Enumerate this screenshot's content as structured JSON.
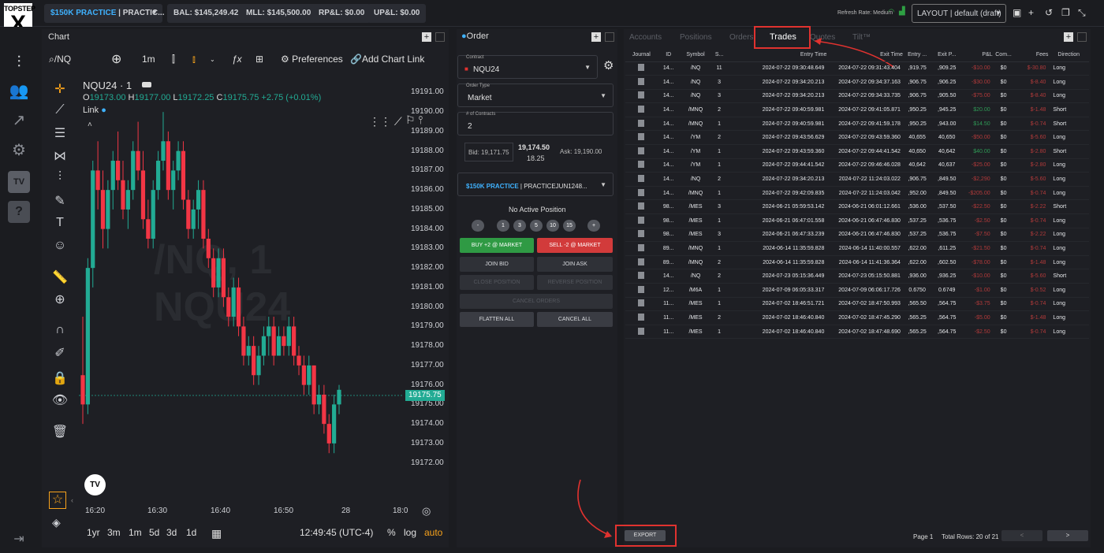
{
  "topbar": {
    "logo_top": "TOPSTEP",
    "logo_bottom": "X",
    "account_highlight": "$150K PRACTICE",
    "account_rest": " | PRACTIC...",
    "bal": "BAL: $145,249.42",
    "mll": "MLL: $145,500.00",
    "rpl": "RP&L: $0.00",
    "upl": "UP&L: $0.00",
    "refresh_rate": "Refresh Rate: Medium",
    "layout": "LAYOUT | default (draft)"
  },
  "chart": {
    "tab_label": "Chart",
    "symbol_search": "/NQ",
    "interval": "1m",
    "preferences": "Preferences",
    "add_chart_link": "Add Chart Link",
    "legend_title": "NQU24 · 1",
    "ohlc": {
      "o_label": "O",
      "o": "19173.00",
      "h_label": "H",
      "h": "19177.00",
      "l_label": "L",
      "l": "19172.25",
      "c_label": "C",
      "c": "19175.75",
      "change": "+2.75 (+0.01%)"
    },
    "link_label": "Link",
    "watermark_line1": "/NQ, 1",
    "watermark_line2": "NQU24",
    "price_tag": "19175.75",
    "timeframes": [
      "1yr",
      "3m",
      "1m",
      "5d",
      "3d",
      "1d"
    ],
    "clock": "12:49:45 (UTC-4)",
    "pct": "%",
    "log": "log",
    "auto": "auto"
  },
  "chart_data": {
    "type": "candlestick",
    "y_ticks": [
      "19191.00",
      "19190.00",
      "19189.00",
      "19188.00",
      "19187.00",
      "19186.00",
      "19185.00",
      "19184.00",
      "19183.00",
      "19182.00",
      "19181.00",
      "19180.00",
      "19179.00",
      "19178.00",
      "19177.00",
      "19176.00",
      "19175.00",
      "19174.00",
      "19173.00",
      "19172.00"
    ],
    "x_ticks": [
      "16:20",
      "16:30",
      "16:40",
      "16:50",
      "28",
      "18:0"
    ],
    "ylim": [
      19171.5,
      19191.3
    ],
    "colors": {
      "up": "#22ab94",
      "down": "#f23645"
    },
    "candles": [
      [
        19176.5,
        19179.5,
        19174.0,
        19175.0
      ],
      [
        19175.0,
        19182.5,
        19174.5,
        19182.0
      ],
      [
        19182.0,
        19187.5,
        19181.0,
        19187.0
      ],
      [
        19187.0,
        19188.5,
        19185.0,
        19186.0
      ],
      [
        19186.0,
        19187.0,
        19183.0,
        19184.0
      ],
      [
        19184.0,
        19186.5,
        19183.0,
        19186.0
      ],
      [
        19186.0,
        19188.0,
        19185.0,
        19187.5
      ],
      [
        19187.5,
        19189.0,
        19186.0,
        19186.5
      ],
      [
        19186.5,
        19187.5,
        19184.5,
        19185.0
      ],
      [
        19185.0,
        19186.5,
        19184.0,
        19186.0
      ],
      [
        19186.0,
        19188.5,
        19185.5,
        19188.0
      ],
      [
        19188.0,
        19189.5,
        19186.5,
        19187.0
      ],
      [
        19187.0,
        19188.0,
        19184.0,
        19184.5
      ],
      [
        19184.5,
        19185.5,
        19183.0,
        19183.5
      ],
      [
        19183.5,
        19186.5,
        19183.0,
        19186.0
      ],
      [
        19186.0,
        19188.0,
        19185.5,
        19187.5
      ],
      [
        19187.5,
        19190.0,
        19187.0,
        19188.5
      ],
      [
        19188.5,
        19189.0,
        19185.5,
        19186.0
      ],
      [
        19186.0,
        19187.5,
        19185.0,
        19187.0
      ],
      [
        19187.0,
        19188.5,
        19186.5,
        19188.0
      ],
      [
        19188.0,
        19188.5,
        19185.0,
        19185.5
      ],
      [
        19185.5,
        19186.0,
        19183.5,
        19184.0
      ],
      [
        19184.0,
        19185.5,
        19183.5,
        19185.0
      ],
      [
        19185.0,
        19186.5,
        19184.0,
        19186.0
      ],
      [
        19186.0,
        19186.5,
        19183.0,
        19183.5
      ],
      [
        19183.5,
        19184.0,
        19182.0,
        19182.5
      ],
      [
        19182.5,
        19183.0,
        19180.5,
        19181.0
      ],
      [
        19181.0,
        19183.0,
        19180.5,
        19182.5
      ],
      [
        19182.5,
        19183.0,
        19180.0,
        19180.5
      ],
      [
        19180.5,
        19181.0,
        19179.0,
        19179.5
      ],
      [
        19179.5,
        19181.5,
        19179.0,
        19181.0
      ],
      [
        19181.0,
        19181.5,
        19178.5,
        19179.0
      ],
      [
        19179.0,
        19179.5,
        19177.0,
        19177.5
      ],
      [
        19177.5,
        19178.5,
        19177.0,
        19178.0
      ],
      [
        19178.0,
        19178.5,
        19176.0,
        19176.5
      ],
      [
        19176.5,
        19178.0,
        19176.0,
        19177.5
      ],
      [
        19177.5,
        19179.0,
        19177.0,
        19178.5
      ],
      [
        19178.5,
        19179.5,
        19177.5,
        19179.0
      ],
      [
        19179.0,
        19179.5,
        19177.0,
        19177.5
      ],
      [
        19177.5,
        19179.0,
        19177.5,
        19178.5
      ],
      [
        19178.5,
        19179.0,
        19177.5,
        19178.0
      ],
      [
        19178.0,
        19179.5,
        19177.5,
        19179.0
      ],
      [
        19179.0,
        19179.5,
        19177.0,
        19177.5
      ],
      [
        19177.5,
        19178.0,
        19176.5,
        19177.0
      ],
      [
        19177.0,
        19177.5,
        19175.5,
        19176.0
      ],
      [
        19176.0,
        19177.5,
        19175.5,
        19177.0
      ],
      [
        19177.0,
        19177.0,
        19174.5,
        19175.0
      ],
      [
        19175.0,
        19176.0,
        19174.5,
        19175.5
      ],
      [
        19175.5,
        19176.0,
        19173.5,
        19174.0
      ],
      [
        19174.0,
        19174.5,
        19172.5,
        19173.0
      ],
      [
        19173.0,
        19175.5,
        19172.5,
        19175.0
      ],
      [
        19175.0,
        19176.0,
        19174.5,
        19175.75
      ]
    ]
  },
  "order": {
    "tab_label": "Order",
    "contract_label": "Contract",
    "contract_value": "NQU24",
    "order_type_label": "Order Type",
    "order_type_value": "Market",
    "contracts_label": "# of Contracts",
    "contracts_value": "2",
    "bid": "Bid: 19,171.75",
    "last": "19,174.50",
    "spread": "18.25",
    "ask": "Ask: 19,190.00",
    "account_highlight": "$150K PRACTICE",
    "account_rest": " | PRACTICEJUN1248...",
    "position_status": "No Active Position",
    "qty_buttons": [
      "-",
      "1",
      "3",
      "5",
      "10",
      "15",
      "+"
    ],
    "buy": "BUY +2 @ MARKET",
    "sell": "SELL -2 @ MARKET",
    "join_bid": "JOIN BID",
    "join_ask": "JOIN ASK",
    "close_position": "CLOSE POSITION",
    "reverse_position": "REVERSE POSITION",
    "cancel_orders": "CANCEL ORDERS",
    "flatten_all": "FLATTEN ALL",
    "cancel_all": "CANCEL ALL"
  },
  "trades": {
    "tabs": [
      "Accounts",
      "Positions",
      "Orders",
      "Trades",
      "Quotes",
      "Tilt™"
    ],
    "columns": [
      "Journal",
      "ID",
      "Symbol",
      "S...",
      "Entry Time",
      "Exit Time",
      "Entry ...",
      "Exit P...",
      "P&L",
      "Com...",
      "Fees",
      "Direction"
    ],
    "rows": [
      [
        "14...",
        "/NQ",
        "11",
        "2024-07-22 09:30:48.649",
        "2024-07-22 09:31:43.404",
        ",919.75",
        ",909.25",
        "-$10.00",
        "$0",
        "$-30.80",
        "Long"
      ],
      [
        "14...",
        "/NQ",
        "3",
        "2024-07-22 09:34:20.213",
        "2024-07-22 09:34:37.163",
        ",906.75",
        ",906.25",
        "-$30.00",
        "$0",
        "$-8.40",
        "Long"
      ],
      [
        "14...",
        "/NQ",
        "3",
        "2024-07-22 09:34:20.213",
        "2024-07-22 09:34:33.735",
        ",906.75",
        ",905.50",
        "-$75.00",
        "$0",
        "$-8.40",
        "Long"
      ],
      [
        "14...",
        "/MNQ",
        "2",
        "2024-07-22 09:40:59.981",
        "2024-07-22 09:41:05.871",
        ",950.25",
        ",945.25",
        "$20.00",
        "$0",
        "$-1.48",
        "Short"
      ],
      [
        "14...",
        "/MNQ",
        "1",
        "2024-07-22 09:40:59.981",
        "2024-07-22 09:41:59.178",
        ",950.25",
        ",943.00",
        "$14.50",
        "$0",
        "$-0.74",
        "Short"
      ],
      [
        "14...",
        "/YM",
        "2",
        "2024-07-22 09:43:56.629",
        "2024-07-22 09:43:59.360",
        "40,655",
        "40,650",
        "-$50.00",
        "$0",
        "$-5.60",
        "Long"
      ],
      [
        "14...",
        "/YM",
        "1",
        "2024-07-22 09:43:59.360",
        "2024-07-22 09:44:41.542",
        "40,650",
        "40,642",
        "$40.00",
        "$0",
        "$-2.80",
        "Short"
      ],
      [
        "14...",
        "/YM",
        "1",
        "2024-07-22 09:44:41.542",
        "2024-07-22 09:46:46.028",
        "40,642",
        "40,637",
        "-$25.00",
        "$0",
        "$-2.80",
        "Long"
      ],
      [
        "14...",
        "/NQ",
        "2",
        "2024-07-22 09:34:20.213",
        "2024-07-22 11:24:03.022",
        ",906.75",
        ",849.50",
        "-$2,290",
        "$0",
        "$-5.60",
        "Long"
      ],
      [
        "14...",
        "/MNQ",
        "1",
        "2024-07-22 09:42:09.835",
        "2024-07-22 11:24:03.042",
        ",952.00",
        ",849.50",
        "-$205.00",
        "$0",
        "$-0.74",
        "Long"
      ],
      [
        "98...",
        "/MES",
        "3",
        "2024-06-21 05:59:53.142",
        "2024-06-21 06:01:12.661",
        ",536.00",
        ",537.50",
        "-$22.50",
        "$0",
        "$-2.22",
        "Short"
      ],
      [
        "98...",
        "/MES",
        "1",
        "2024-06-21 06:47:01.558",
        "2024-06-21 06:47:46.830",
        ",537.25",
        ",536.75",
        "-$2.50",
        "$0",
        "$-0.74",
        "Long"
      ],
      [
        "98...",
        "/MES",
        "3",
        "2024-06-21 06:47:33.239",
        "2024-06-21 06:47:46.830",
        ",537.25",
        ",536.75",
        "-$7.50",
        "$0",
        "$-2.22",
        "Long"
      ],
      [
        "89...",
        "/MNQ",
        "1",
        "2024-06-14 11:35:59.828",
        "2024-06-14 11:40:00.557",
        ",622.00",
        ",611.25",
        "-$21.50",
        "$0",
        "$-0.74",
        "Long"
      ],
      [
        "89...",
        "/MNQ",
        "2",
        "2024-06-14 11:35:59.828",
        "2024-06-14 11:41:36.364",
        ",622.00",
        ",602.50",
        "-$78.00",
        "$0",
        "$-1.48",
        "Long"
      ],
      [
        "14...",
        "/NQ",
        "2",
        "2024-07-23 05:15:36.449",
        "2024-07-23 05:15:50.881",
        ",936.00",
        ",936.25",
        "-$10.00",
        "$0",
        "$-5.60",
        "Short"
      ],
      [
        "12...",
        "/M6A",
        "1",
        "2024-07-09 06:05:33.317",
        "2024-07-09 06:06:17.726",
        "0.6750",
        "0.6749",
        "-$1.00",
        "$0",
        "$-0.52",
        "Long"
      ],
      [
        "11...",
        "/MES",
        "1",
        "2024-07-02 18:46:51.721",
        "2024-07-02 18:47:50.993",
        ",565.50",
        ",564.75",
        "-$3.75",
        "$0",
        "$-0.74",
        "Long"
      ],
      [
        "11...",
        "/MES",
        "2",
        "2024-07-02 18:46:40.840",
        "2024-07-02 18:47:45.290",
        ",565.25",
        ",564.75",
        "-$5.00",
        "$0",
        "$-1.48",
        "Long"
      ],
      [
        "11...",
        "/MES",
        "1",
        "2024-07-02 18:46:40.840",
        "2024-07-02 18:47:48.690",
        ",565.25",
        ",564.75",
        "-$2.50",
        "$0",
        "$-0.74",
        "Long"
      ]
    ],
    "export": "EXPORT",
    "page": "Page 1",
    "total_rows": "Total Rows: 20 of 21",
    "prev": "<",
    "next": ">"
  }
}
